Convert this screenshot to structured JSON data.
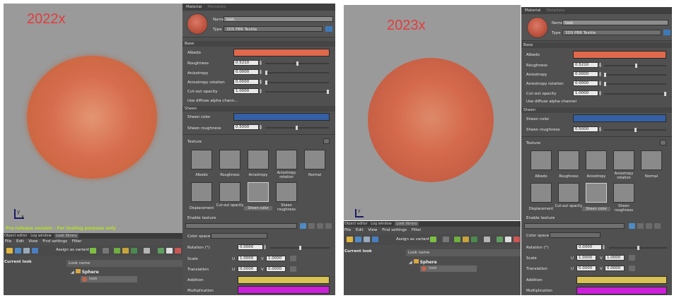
{
  "left": {
    "version_label": "2022x",
    "warning": "Pre-release version - For testing purpose only",
    "panel": {
      "tab_material": "Material",
      "tab_metadata": "Metadata",
      "name_label": "Name",
      "name_value": "look",
      "type_label": "Type",
      "type_value": "3DS PBR Textile",
      "base_section": "Base",
      "albedo_label": "Albedo",
      "albedo_color": "#e0694b",
      "roughness_label": "Roughness",
      "roughness_value": "0.5210",
      "anisotropy_label": "Anisotropy",
      "anisotropy_value": "0.0000",
      "anisotropy_rotation_label": "Anisotropy rotation",
      "anisotropy_rotation_value": "0.0000",
      "cutout_label": "Cut-out opacity",
      "cutout_value": "1.0000",
      "diffuse_alpha_label": "Use diffuse alpha chann...",
      "sheen_section": "Sheen",
      "sheen_color_label": "Sheen color",
      "sheen_color": "#3560a5",
      "sheen_rough_label": "Sheen roughness",
      "sheen_rough_value": "0.5000",
      "texture_label": "Texture",
      "tex_albedo": "Albedo",
      "tex_roughness": "Roughness",
      "tex_anisotropy": "Anisotropy",
      "tex_aniso_rot": "Anisotropy rotation",
      "tex_normal": "Normal",
      "tex_displacement": "Displacement",
      "tex_cutout": "Cut-out opacity",
      "tex_sheen_color": "Sheen color",
      "tex_sheen_rough": "Sheen roughness",
      "enable_texture": "Enable texture",
      "color_space": "Color space",
      "rotation_label": "Rotation (°)",
      "rotation_value": "0.0000",
      "scale_label": "Scale",
      "scale_u": "1.0000",
      "scale_v": "1.0000",
      "translation_label": "Translation",
      "trans_u": "0.0000",
      "trans_v": "0.0000",
      "addition_label": "Addition",
      "addition_color": "#d9c254",
      "multiplication_label": "Multiplication",
      "multiplication_color": "#cc1fd8"
    },
    "bottom": {
      "tabs": [
        "Object editor",
        "Log window",
        "Look library"
      ],
      "menu": [
        "File",
        "Edit",
        "View",
        "Find settings",
        "Filter"
      ],
      "assign_label": "Assign as variant",
      "current_look": "Current look",
      "look_name_header": "Look name",
      "tree_root": "Sphere",
      "tree_child": "look"
    }
  },
  "right": {
    "version_label": "2023x",
    "panel": {
      "tab_material": "Material",
      "tab_metadata": "Metadata",
      "name_label": "Name",
      "name_value": "look",
      "type_label": "Type",
      "type_value": "3DS PBR Textile",
      "base_section": "Base",
      "albedo_label": "Albedo",
      "albedo_color": "#e0694b",
      "roughness_label": "Roughness",
      "roughness_value": "0.5210",
      "anisotropy_label": "Anisotropy",
      "anisotropy_value": "0.0000",
      "anisotropy_rotation_label": "Anisotropy rotation",
      "anisotropy_rotation_value": "0.0000",
      "cutout_label": "Cut-out opacity",
      "cutout_value": "1.0000",
      "diffuse_alpha_label": "Use diffuse alpha channel",
      "sheen_section": "Sheen",
      "sheen_color_label": "Sheen color",
      "sheen_color": "#3560a5",
      "sheen_rough_label": "Sheen roughness",
      "sheen_rough_value": "0.5000",
      "texture_label": "Texture",
      "tex_albedo": "Albedo",
      "tex_roughness": "Roughness",
      "tex_anisotropy": "Anisotropy",
      "tex_aniso_rot": "Anisotropy rotation",
      "tex_normal": "Normal",
      "tex_displacement": "Displacement",
      "tex_cutout": "Cut-out opacity",
      "tex_sheen_color": "Sheen color",
      "tex_sheen_rough": "Sheen roughness",
      "enable_texture": "Enable texture",
      "color_space": "Color space",
      "rotation_label": "Rotation (°)",
      "rotation_value": "0.0000",
      "scale_label": "Scale",
      "scale_u": "1.0000",
      "scale_v": "1.0000",
      "translation_label": "Translation",
      "trans_u": "0.0000",
      "trans_v": "0.0000",
      "addition_label": "Addition",
      "addition_color": "#d9c254",
      "multiplication_label": "Multiplication",
      "multiplication_color": "#cc1fd8"
    },
    "bottom": {
      "tabs": [
        "Object editor",
        "Log window",
        "Look library"
      ],
      "menu": [
        "File",
        "Edit",
        "View",
        "Find settings",
        "Filter"
      ],
      "assign_label": "Assign as variant",
      "current_look": "Current look",
      "look_name_header": "Look name",
      "tree_root": "Sphere",
      "tree_child": "look"
    }
  },
  "axis": {
    "y": "y",
    "x": "x"
  },
  "uv": {
    "u": "U",
    "v": "V"
  }
}
